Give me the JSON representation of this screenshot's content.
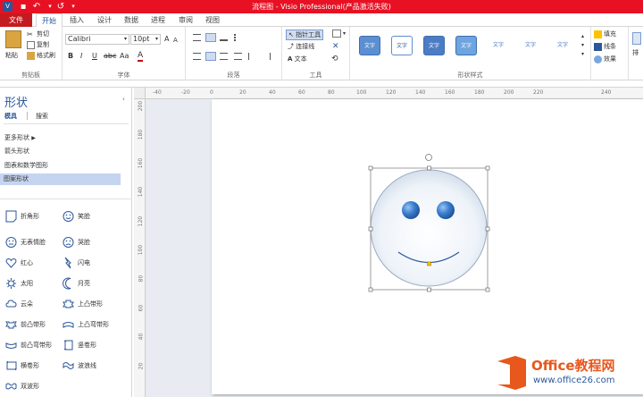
{
  "title": "流程图 - Visio Professional(产品激活失败)",
  "tabs": [
    "文件",
    "开始",
    "插入",
    "设计",
    "数据",
    "进程",
    "审阅",
    "视图"
  ],
  "clipboard": {
    "paste": "粘贴",
    "cut": "剪切",
    "copy": "复制",
    "format_painter": "格式刷",
    "label": "剪贴板"
  },
  "font": {
    "name": "Calibri",
    "size": "10pt",
    "label": "字体"
  },
  "paragraph": {
    "label": "段落"
  },
  "tools": {
    "pointer": "指针工具",
    "connector": "连接线",
    "text": "文本",
    "label": "工具"
  },
  "shape_styles": {
    "sample": "文字",
    "label": "形状样式"
  },
  "format": {
    "fill": "填充",
    "line": "线条",
    "effects": "效果"
  },
  "arrange": {
    "label": "排"
  },
  "shapes_pane": {
    "title": "形状",
    "tab_stencil": "模具",
    "tab_search": "搜索",
    "more_shapes": "更多形状",
    "stencils": [
      "箭头形状",
      "图表和数学图形",
      "图案形状"
    ],
    "items": [
      [
        "折角形",
        "笑脸"
      ],
      [
        "无表情脸",
        "哭脸"
      ],
      [
        "红心",
        "闪电"
      ],
      [
        "太阳",
        "月亮"
      ],
      [
        "云朵",
        "上凸带形"
      ],
      [
        "前凸带形",
        "上凸弯带形"
      ],
      [
        "前凸弯带形",
        "竖卷形"
      ],
      [
        "横卷形",
        "波浪线"
      ],
      [
        "双波形",
        ""
      ]
    ]
  },
  "ruler_top": [
    "-40",
    "-20",
    "0",
    "20",
    "40",
    "60",
    "80",
    "100",
    "120",
    "140",
    "160",
    "180",
    "200",
    "220",
    "240"
  ],
  "ruler_left": [
    "200",
    "180",
    "160",
    "140",
    "120",
    "100",
    "80",
    "60",
    "40",
    "20"
  ],
  "watermark": {
    "brand": "Office教程网",
    "url": "www.office26.com"
  },
  "colors": {
    "title_bar": "#e81123",
    "accent": "#2b579a",
    "selected_stencil": "#c5d4f0"
  }
}
